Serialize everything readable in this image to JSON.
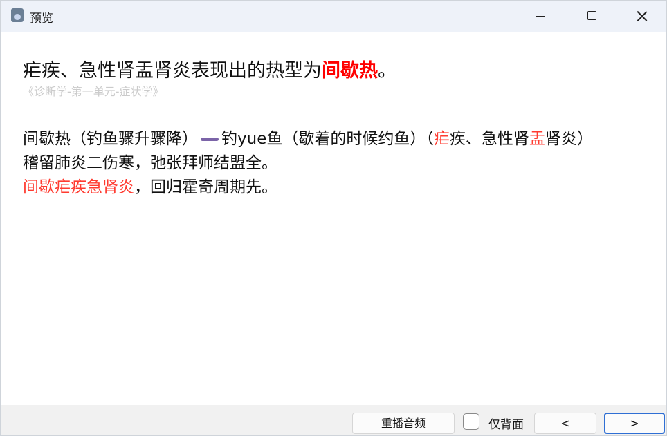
{
  "window": {
    "title": "预览",
    "icon": "app-icon"
  },
  "card": {
    "question_text": "疟疾、急性肾盂肾炎表现出的热型为",
    "question_answer": "间歇热",
    "question_end": "。",
    "source": "《诊断学-第一单元-症状学》",
    "line1_a": "间歇热（钓鱼骤升骤降）",
    "line1_b": "钓yue鱼（歇着的时候约鱼）（",
    "line1_red1": "疟",
    "line1_c": "疾、急性肾",
    "line1_red2": "盂",
    "line1_d": "肾炎）",
    "line2": "稽留肺炎二伤寒，弛张拜师结盟全。",
    "line3_red": "间歇疟疾急肾炎",
    "line3_rest": "，回归霍奇周期先。"
  },
  "bottom": {
    "replay_label": "重播音频",
    "back_only_label": "仅背面",
    "back_only_checked": false,
    "prev_label": "<",
    "next_label": ">"
  },
  "colors": {
    "answer_red": "#ff0000",
    "mnemonic_red": "#ff3b30",
    "dash_purple": "#7b64a8",
    "focus_blue": "#2f6fd4"
  }
}
